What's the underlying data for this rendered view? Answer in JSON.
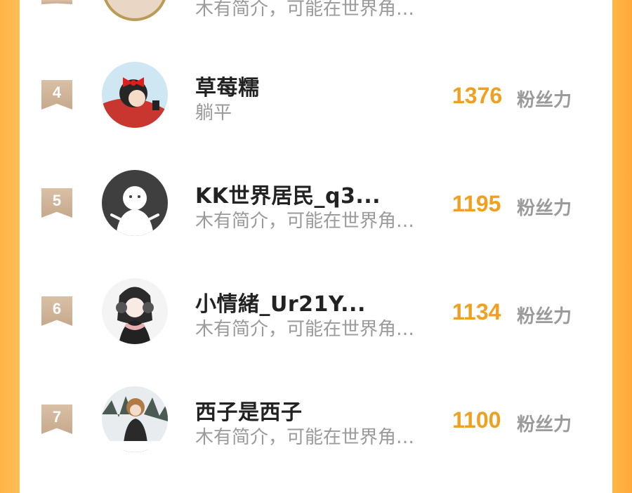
{
  "rows": [
    {
      "rank": "",
      "name": "",
      "bio": "木有简介，可能在世界角…",
      "score": "",
      "unit": ""
    },
    {
      "rank": "4",
      "name": "草莓糯",
      "bio": "躺平",
      "score": "1376",
      "unit": "粉丝力"
    },
    {
      "rank": "5",
      "name": "KK世界居民_q3...",
      "bio": "木有简介，可能在世界角…",
      "score": "1195",
      "unit": "粉丝力"
    },
    {
      "rank": "6",
      "name": "小情緒_Ur21Y...",
      "bio": "木有简介，可能在世界角…",
      "score": "1134",
      "unit": "粉丝力"
    },
    {
      "rank": "7",
      "name": "西子是西子",
      "bio": "木有简介，可能在世界角…",
      "score": "1100",
      "unit": "粉丝力"
    }
  ],
  "colors": {
    "accent": "#f0a020",
    "rank_badge": "#c9ab8e",
    "background": "#ffb547",
    "card": "#ffffff"
  },
  "icons": [
    "rank-badge",
    "user-avatar",
    "default-avatar-icon"
  ]
}
